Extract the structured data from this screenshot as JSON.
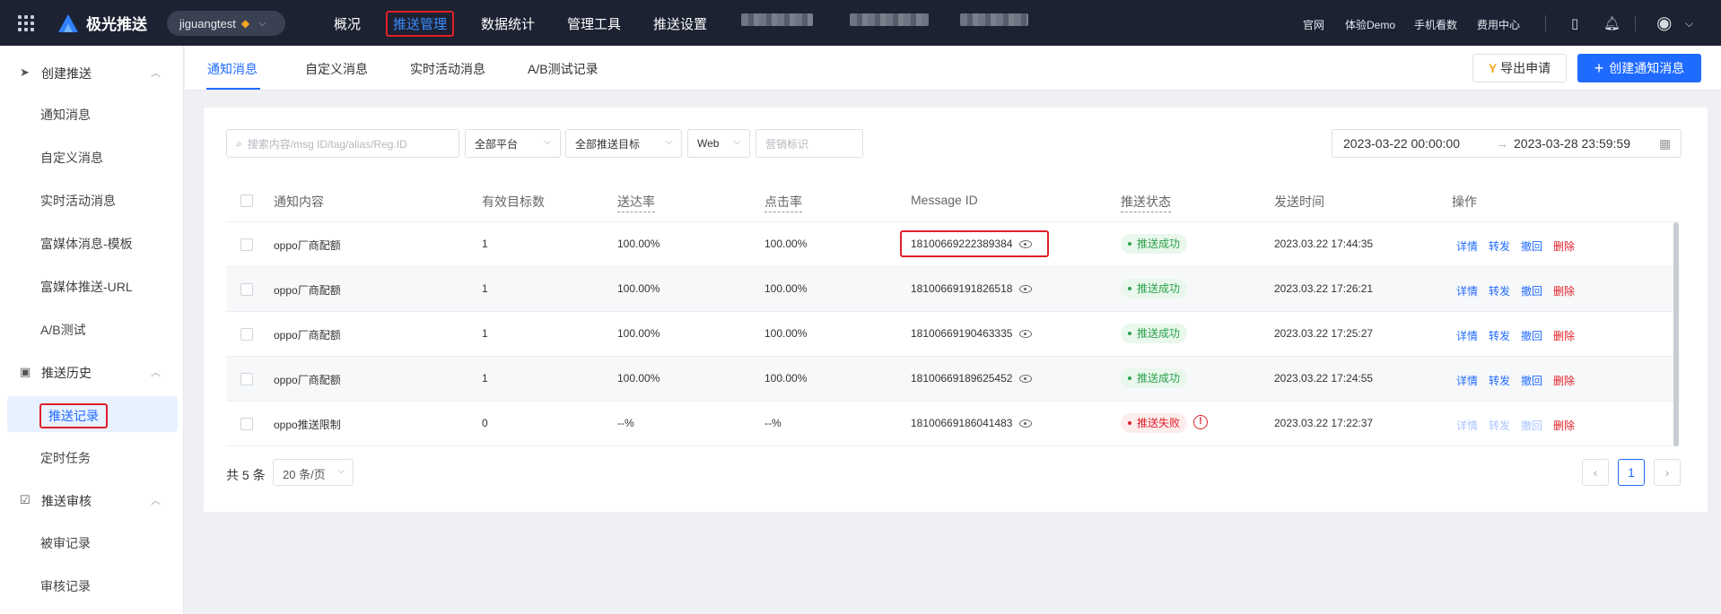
{
  "topbar": {
    "brand": "极光推送",
    "account": "jiguangtest",
    "nav": [
      "概况",
      "推送管理",
      "数据统计",
      "管理工具",
      "推送设置"
    ],
    "links": [
      "官网",
      "体验Demo",
      "手机看数",
      "费用中心"
    ]
  },
  "sidebar": {
    "groups": [
      {
        "label": "创建推送",
        "items": [
          "通知消息",
          "自定义消息",
          "实时活动消息",
          "富媒体消息-模板",
          "富媒体推送-URL",
          "A/B测试"
        ]
      },
      {
        "label": "推送历史",
        "items": [
          "推送记录",
          "定时任务"
        ]
      },
      {
        "label": "推送审核",
        "items": [
          "被审记录",
          "审核记录"
        ]
      }
    ]
  },
  "tabs": [
    "通知消息",
    "自定义消息",
    "实时活动消息",
    "A/B测试记录"
  ],
  "actions": {
    "export": "导出申请",
    "create": "创建通知消息"
  },
  "filters": {
    "search_placeholder": "搜索内容/msg ID/tag/alias/Reg.ID",
    "platform": "全部平台",
    "target": "全部推送目标",
    "web": "Web",
    "marketing_placeholder": "营销标识",
    "date_start": "2023-03-22 00:00:00",
    "date_end": "2023-03-28 23:59:59"
  },
  "table": {
    "columns": [
      "通知内容",
      "有效目标数",
      "送达率",
      "点击率",
      "Message ID",
      "推送状态",
      "发送时间",
      "操作"
    ],
    "rows": [
      {
        "content": "oppo厂商配额",
        "targets": "1",
        "delivery": "100.00%",
        "click": "100.00%",
        "msg_id": "18100669222389384",
        "status": "推送成功",
        "time": "2023.03.22 17:44:35"
      },
      {
        "content": "oppo厂商配额",
        "targets": "1",
        "delivery": "100.00%",
        "click": "100.00%",
        "msg_id": "18100669191826518",
        "status": "推送成功",
        "time": "2023.03.22 17:26:21"
      },
      {
        "content": "oppo厂商配额",
        "targets": "1",
        "delivery": "100.00%",
        "click": "100.00%",
        "msg_id": "18100669190463335",
        "status": "推送成功",
        "time": "2023.03.22 17:25:27"
      },
      {
        "content": "oppo厂商配额",
        "targets": "1",
        "delivery": "100.00%",
        "click": "100.00%",
        "msg_id": "18100669189625452",
        "status": "推送成功",
        "time": "2023.03.22 17:24:55"
      },
      {
        "content": "oppo推送限制",
        "targets": "0",
        "delivery": "--%",
        "click": "--%",
        "msg_id": "18100669186041483",
        "status": "推送失败",
        "time": "2023.03.22 17:22:37"
      }
    ],
    "ops": [
      "详情",
      "转发",
      "撤回",
      "删除"
    ]
  },
  "pagination": {
    "total": "共 5 条",
    "page_size": "20 条/页",
    "current": "1"
  },
  "colors": {
    "primary": "#1f6bff",
    "topbar": "#1c2232",
    "danger": "#e0202a",
    "success": "#2ba24c"
  }
}
